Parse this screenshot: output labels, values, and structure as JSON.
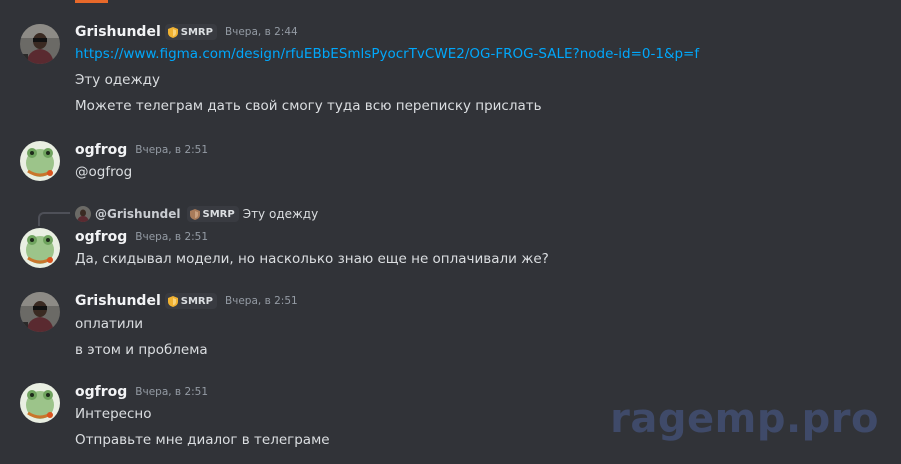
{
  "colors": {
    "background": "#313338",
    "username": "#f2f3f5",
    "text": "#dbdee1",
    "link": "#00a8fc",
    "timestamp": "#949ba4",
    "watermark": "#3f4a69",
    "tag_bg": "#393b41"
  },
  "messages": [
    {
      "author": "Grishundel",
      "tag": "SMRP",
      "timestamp": "Вчера, в 2:44",
      "avatar_icon": "avatar-grishundel-icon",
      "lines": [
        "https://www.figma.com/design/rfuEBbESmlsPyocrTvCWE2/OG-FROG-SALE?node-id=0-1&p=f",
        "Эту одежду",
        "Можете телеграм дать свой смогу туда всю переписку прислать"
      ]
    },
    {
      "author": "ogfrog",
      "timestamp": "Вчера, в 2:51",
      "avatar_icon": "avatar-ogfrog-icon",
      "lines": [
        "@ogfrog"
      ]
    },
    {
      "author": "ogfrog",
      "timestamp": "Вчера, в 2:51",
      "avatar_icon": "avatar-ogfrog-icon",
      "reply": {
        "author": "@Grishundel",
        "tag": "SMRP",
        "text": "Эту одежду"
      },
      "lines": [
        "Да, скидывал модели, но насколько знаю еще не оплачивали же?"
      ]
    },
    {
      "author": "Grishundel",
      "tag": "SMRP",
      "timestamp": "Вчера, в 2:51",
      "avatar_icon": "avatar-grishundel-icon",
      "lines": [
        "оплатили",
        "в этом и проблема"
      ]
    },
    {
      "author": "ogfrog",
      "timestamp": "Вчера, в 2:51",
      "avatar_icon": "avatar-ogfrog-icon",
      "lines": [
        "Интересно",
        "Отправьте мне диалог в телеграме"
      ]
    }
  ],
  "watermark": "ragemp.pro"
}
